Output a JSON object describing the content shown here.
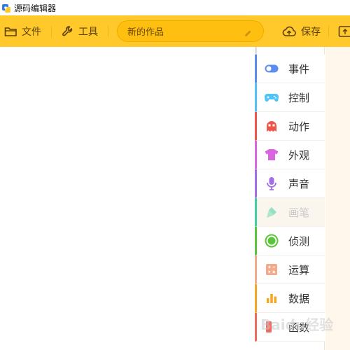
{
  "window": {
    "title": "源码编辑器"
  },
  "toolbar": {
    "file_label": "文件",
    "tools_label": "工具",
    "project_name": "新的作品",
    "save_label": "保存"
  },
  "palette": {
    "categories": [
      {
        "label": "事件",
        "color": "#5b8def",
        "icon": "toggle-icon"
      },
      {
        "label": "控制",
        "color": "#4fc3f7",
        "icon": "gamepad-icon"
      },
      {
        "label": "动作",
        "color": "#f0554a",
        "icon": "ghost-icon"
      },
      {
        "label": "外观",
        "color": "#d966e0",
        "icon": "tshirt-icon"
      },
      {
        "label": "声音",
        "color": "#a36ee8",
        "icon": "microphone-icon"
      },
      {
        "label": "画笔",
        "color": "#3fcfa2",
        "icon": "brush-icon"
      },
      {
        "label": "侦测",
        "color": "#5ac43a",
        "icon": "detect-icon"
      },
      {
        "label": "运算",
        "color": "#f3a98b",
        "icon": "calculator-icon"
      },
      {
        "label": "数据",
        "color": "#f5a623",
        "icon": "bar-chart-icon"
      },
      {
        "label": "函数",
        "color": "#f06a5e",
        "icon": "function-icon"
      }
    ],
    "active_index": 5
  },
  "watermark": "Baidu经验"
}
